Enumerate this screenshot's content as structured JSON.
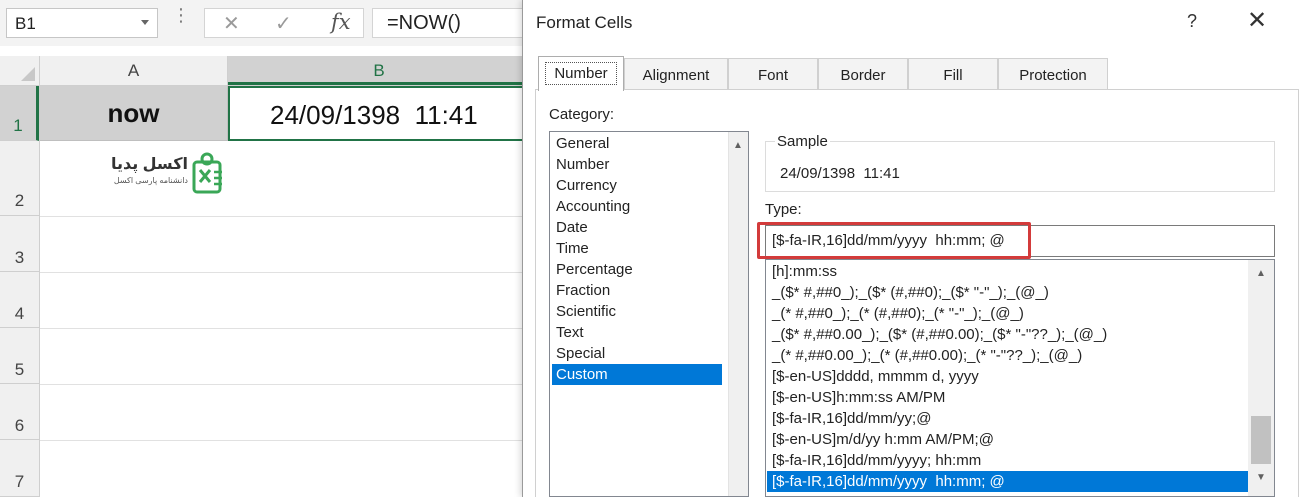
{
  "excel": {
    "namebox": "B1",
    "formula": "=NOW()",
    "col_a": "A",
    "col_b": "B",
    "rows": [
      "1",
      "2",
      "3",
      "4",
      "5",
      "6",
      "7"
    ],
    "cell_a1": "now",
    "cell_b1": "24/09/1398  11:41",
    "logo_text": "اکسل پدیا",
    "logo_subtext": "دانشنامه پارسی اکسل",
    "icons": {
      "namebox_dropdown": "chevron-down-icon",
      "cancel": "close-icon",
      "enter": "check-icon",
      "insert_function": "fx-icon"
    },
    "accent_color": "#217346"
  },
  "dialog": {
    "title": "Format Cells",
    "help": "?",
    "close": "✕",
    "tabs": [
      "Number",
      "Alignment",
      "Font",
      "Border",
      "Fill",
      "Protection"
    ],
    "active_tab": "Number",
    "category_label": "Category:",
    "categories": [
      "General",
      "Number",
      "Currency",
      "Accounting",
      "Date",
      "Time",
      "Percentage",
      "Fraction",
      "Scientific",
      "Text",
      "Special",
      "Custom"
    ],
    "selected_category": "Custom",
    "sample_label": "Sample",
    "sample_value": "24/09/1398  11:41",
    "type_label": "Type:",
    "type_value": "[$-fa-IR,16]dd/mm/yyyy  hh:mm; @",
    "formats": [
      "[h]:mm:ss",
      "_($* #,##0_);_($* (#,##0);_($* \"-\"_);_(@_)",
      "_(* #,##0_);_(* (#,##0);_(* \"-\"_);_(@_)",
      "_($* #,##0.00_);_($* (#,##0.00);_($* \"-\"??_);_(@_)",
      "_(* #,##0.00_);_(* (#,##0.00);_(* \"-\"??_);_(@_)",
      "[$-en-US]dddd, mmmm d, yyyy",
      "[$-en-US]h:mm:ss AM/PM",
      "[$-fa-IR,16]dd/mm/yy;@",
      "[$-en-US]m/d/yy h:mm AM/PM;@",
      "[$-fa-IR,16]dd/mm/yyyy; hh:mm",
      "[$-fa-IR,16]dd/mm/yyyy  hh:mm; @"
    ],
    "selected_format_index": 10,
    "selection_color": "#0078d7",
    "highlight_color": "#d33b3b"
  }
}
